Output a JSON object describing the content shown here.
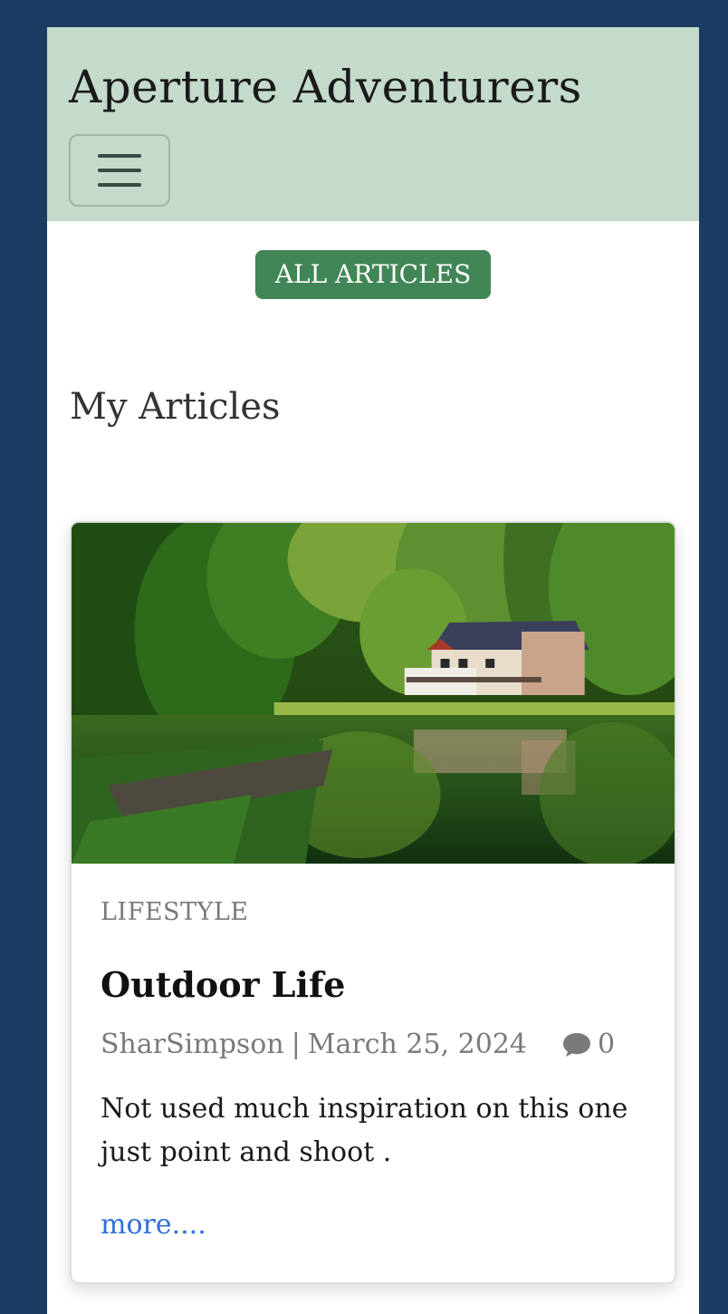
{
  "navbar": {
    "brand": "Aperture Adventurers",
    "toggler_icon": "hamburger-menu-icon"
  },
  "actions": {
    "all_articles_label": "ALL ARTICLES"
  },
  "section": {
    "title": "My Articles"
  },
  "articles": [
    {
      "category": "LIFESTYLE",
      "title": "Outdoor Life",
      "author": "SharSimpson",
      "separator": "|",
      "date": "March 25, 2024",
      "comment_icon": "comment-icon",
      "comment_count": "0",
      "excerpt": "Not used much inspiration on this one just point and shoot .",
      "more_label": "more...."
    }
  ],
  "colors": {
    "background": "#1b3d63",
    "navbar": "#c4dacb",
    "accent_button": "#418656",
    "link": "#2f6fd8"
  }
}
